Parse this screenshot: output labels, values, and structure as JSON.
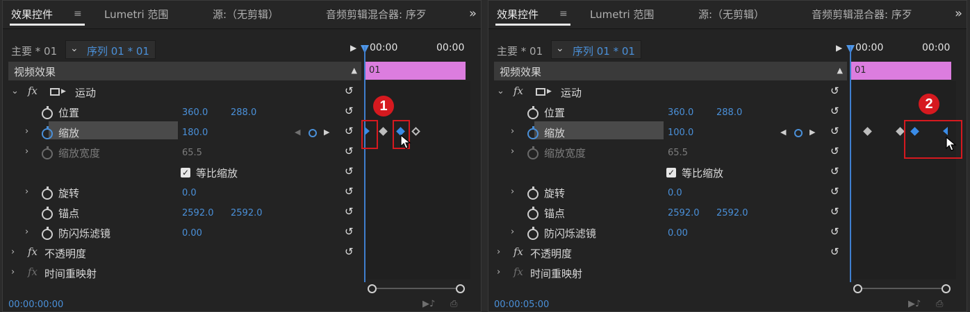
{
  "panels": [
    {
      "tabs": {
        "effect_controls": "效果控件",
        "menu_icon": "≡",
        "lumetri": "Lumetri 范围",
        "source": "源:（无剪辑）",
        "audio_mixer": "音频剪辑混合器: 序歹",
        "overflow": "»"
      },
      "source": {
        "master": "主要 * 01",
        "sequence": "序列 01 * 01",
        "time_start": "00:00",
        "time_end": "00:00"
      },
      "video_effects_label": "视频效果",
      "clip_label": "01",
      "motion": {
        "label": "运动",
        "position": {
          "label": "位置",
          "x": "360.0",
          "y": "288.0"
        },
        "scale": {
          "label": "缩放",
          "value": "180.0"
        },
        "scale_width": {
          "label": "缩放宽度",
          "value": "65.5"
        },
        "uniform_scale": {
          "label": "等比缩放",
          "checked": true
        },
        "rotation": {
          "label": "旋转",
          "value": "0.0"
        },
        "anchor": {
          "label": "锚点",
          "x": "2592.0",
          "y": "2592.0"
        },
        "anti_flicker": {
          "label": "防闪烁滤镜",
          "value": "0.00"
        }
      },
      "opacity_label": "不透明度",
      "time_remap_label": "时间重映射",
      "timecode": "00:00:00:00",
      "callout_number": "1",
      "reset_icon": "↺"
    },
    {
      "tabs": {
        "effect_controls": "效果控件",
        "menu_icon": "≡",
        "lumetri": "Lumetri 范围",
        "source": "源:（无剪辑）",
        "audio_mixer": "音频剪辑混合器: 序歹",
        "overflow": "»"
      },
      "source": {
        "master": "主要 * 01",
        "sequence": "序列 01 * 01",
        "time_start": "00:00",
        "time_end": "00:00"
      },
      "video_effects_label": "视频效果",
      "clip_label": "01",
      "motion": {
        "label": "运动",
        "position": {
          "label": "位置",
          "x": "360.0",
          "y": "288.0"
        },
        "scale": {
          "label": "缩放",
          "value": "100.0"
        },
        "scale_width": {
          "label": "缩放宽度",
          "value": "65.5"
        },
        "uniform_scale": {
          "label": "等比缩放",
          "checked": true
        },
        "rotation": {
          "label": "旋转",
          "value": "0.0"
        },
        "anchor": {
          "label": "锚点",
          "x": "2592.0",
          "y": "2592.0"
        },
        "anti_flicker": {
          "label": "防闪烁滤镜",
          "value": "0.00"
        }
      },
      "opacity_label": "不透明度",
      "time_remap_label": "时间重映射",
      "timecode": "00:00:05:00",
      "callout_number": "2",
      "reset_icon": "↺"
    }
  ],
  "colors": {
    "accent": "#4a90d9",
    "clip": "#dc7ddf",
    "callout": "#d6191f"
  }
}
